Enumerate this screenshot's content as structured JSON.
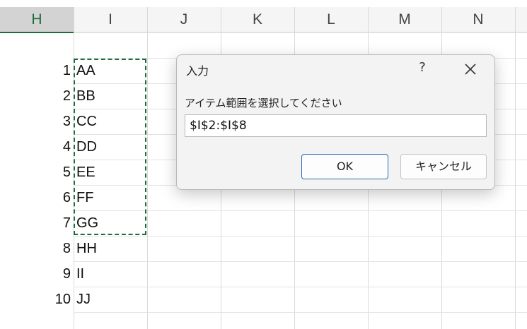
{
  "columns": [
    "H",
    "I",
    "J",
    "K",
    "L",
    "M",
    "N"
  ],
  "selected_column": "H",
  "rows": [
    {
      "num": "1",
      "value": "AA"
    },
    {
      "num": "2",
      "value": "BB"
    },
    {
      "num": "3",
      "value": "CC"
    },
    {
      "num": "4",
      "value": "DD"
    },
    {
      "num": "5",
      "value": "EE"
    },
    {
      "num": "6",
      "value": "FF"
    },
    {
      "num": "7",
      "value": "GG"
    },
    {
      "num": "8",
      "value": "HH"
    },
    {
      "num": "9",
      "value": "II"
    },
    {
      "num": "10",
      "value": "JJ"
    }
  ],
  "dialog": {
    "title": "入力",
    "help": "?",
    "prompt": "アイテム範囲を選択してください",
    "input_value": "$I$2:$I$8",
    "ok_label": "OK",
    "cancel_label": "キャンセル",
    "close_icon": "close-icon"
  },
  "colors": {
    "selected_header_bg": "#d3d3d3",
    "selected_header_text": "#1e6b3c",
    "marquee": "#1e6b3c",
    "ok_border": "#2b6cb0"
  }
}
